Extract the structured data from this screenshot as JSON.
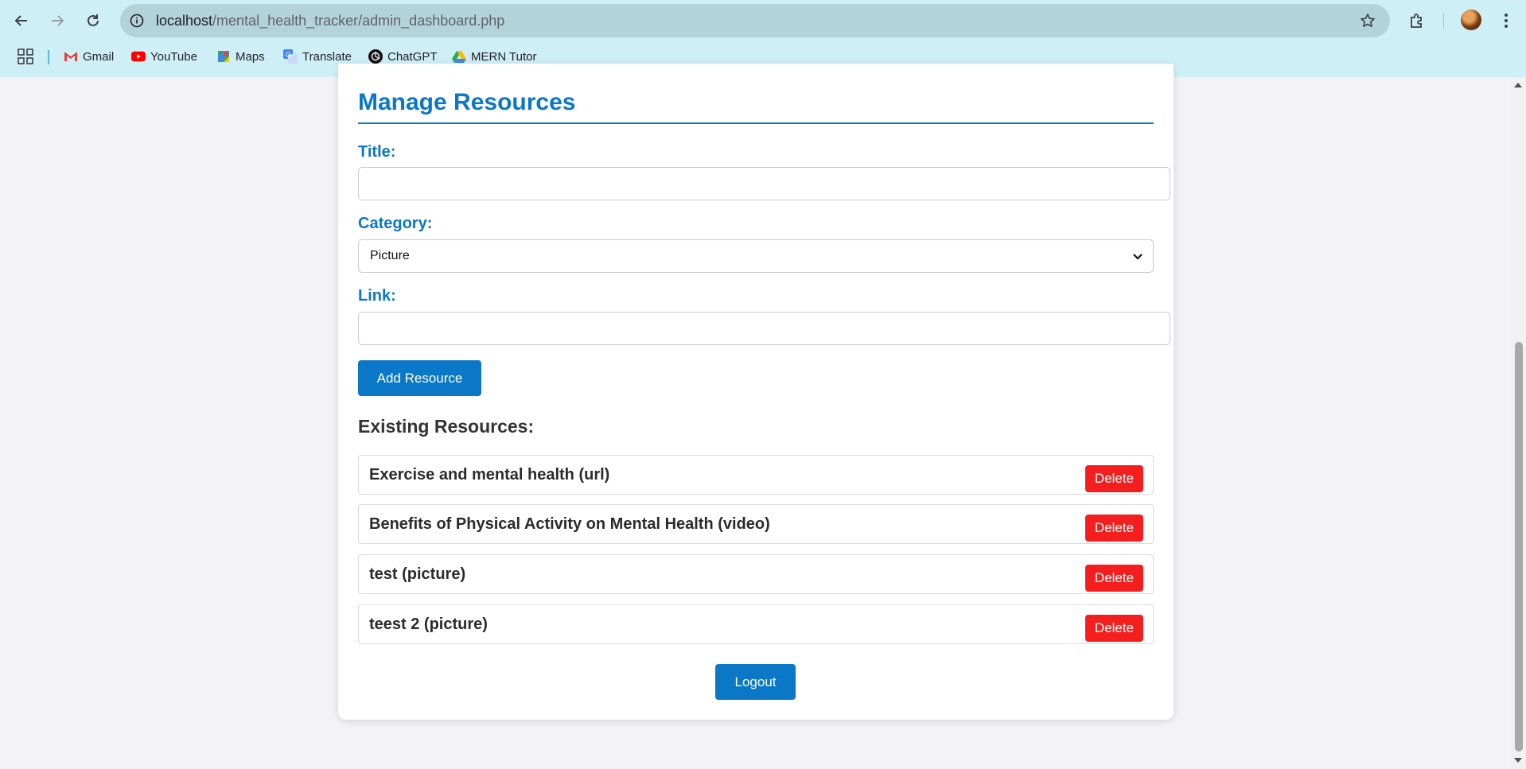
{
  "browser": {
    "url_host": "localhost",
    "url_path": "/mental_health_tracker/admin_dashboard.php",
    "bookmarks": [
      {
        "label": "Gmail",
        "icon": "gmail-icon"
      },
      {
        "label": "YouTube",
        "icon": "youtube-icon"
      },
      {
        "label": "Maps",
        "icon": "maps-icon"
      },
      {
        "label": "Translate",
        "icon": "translate-icon"
      },
      {
        "label": "ChatGPT",
        "icon": "chatgpt-icon"
      },
      {
        "label": "MERN Tutor",
        "icon": "drive-icon"
      }
    ]
  },
  "page": {
    "section_title": "Manage Resources",
    "form": {
      "title_label": "Title:",
      "title_value": "",
      "category_label": "Category:",
      "category_selected": "Picture",
      "link_label": "Link:",
      "link_value": "",
      "submit_label": "Add Resource"
    },
    "existing_heading": "Existing Resources:",
    "resources": [
      {
        "title": "Exercise and mental health (url)",
        "action": "Delete"
      },
      {
        "title": "Benefits of Physical Activity on Mental Health (video)",
        "action": "Delete"
      },
      {
        "title": "test (picture)",
        "action": "Delete"
      },
      {
        "title": "teest 2 (picture)",
        "action": "Delete"
      }
    ],
    "logout_label": "Logout"
  },
  "colors": {
    "chrome_bg": "#cfeff7",
    "omnibox_bg": "#b3d3db",
    "accent": "#0a78c6",
    "danger": "#f41e1e",
    "page_bg": "#f3f2f7"
  }
}
